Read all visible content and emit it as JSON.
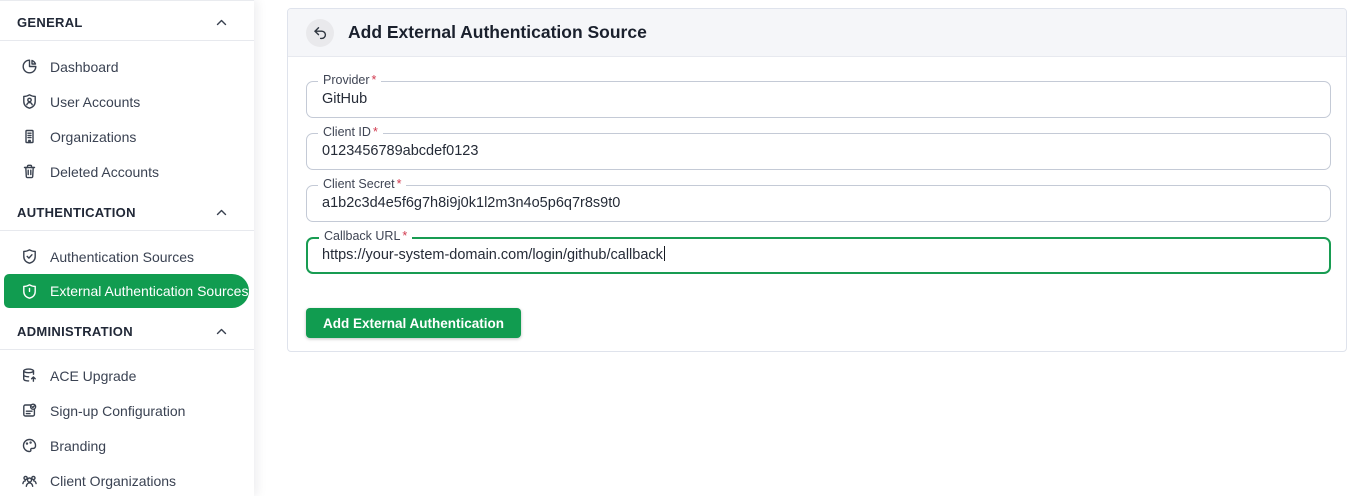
{
  "colors": {
    "accent_green": "#119c50",
    "focus_border_green": "#189c52",
    "required_red": "#d13a4f",
    "card_header_bg": "#f5f6f9"
  },
  "sidebar": {
    "sections": [
      {
        "label": "GENERAL",
        "collapse_icon": "chevron-up-icon",
        "items": [
          {
            "icon": "pie-chart-icon",
            "label": "Dashboard"
          },
          {
            "icon": "user-badge-icon",
            "label": "User Accounts"
          },
          {
            "icon": "building-icon",
            "label": "Organizations"
          },
          {
            "icon": "trash-icon",
            "label": "Deleted Accounts"
          }
        ]
      },
      {
        "label": "AUTHENTICATION",
        "collapse_icon": "chevron-up-icon",
        "items": [
          {
            "icon": "shield-check-icon",
            "label": "Authentication Sources"
          },
          {
            "icon": "shield-alert-icon",
            "label": "External Authentication Sources",
            "active": true
          }
        ]
      },
      {
        "label": "ADMINISTRATION",
        "collapse_icon": "chevron-up-icon",
        "items": [
          {
            "icon": "database-upgrade-icon",
            "label": "ACE Upgrade"
          },
          {
            "icon": "document-check-icon",
            "label": "Sign-up Configuration"
          },
          {
            "icon": "palette-icon",
            "label": "Branding"
          },
          {
            "icon": "people-icon",
            "label": "Client Organizations"
          }
        ]
      }
    ]
  },
  "main": {
    "back_icon": "back-arrow-icon",
    "title": "Add External Authentication Source",
    "required_marker": "*",
    "fields": [
      {
        "label": "Provider",
        "required": true,
        "focused": false,
        "value": "GitHub"
      },
      {
        "label": "Client ID",
        "required": true,
        "focused": false,
        "value": "0123456789abcdef0123"
      },
      {
        "label": "Client Secret",
        "required": true,
        "focused": false,
        "value": "a1b2c3d4e5f6g7h8i9j0k1l2m3n4o5p6q7r8s9t0"
      },
      {
        "label": "Callback URL",
        "required": true,
        "focused": true,
        "value": "https://your-system-domain.com/login/github/callback"
      }
    ],
    "submit_button": "Add External Authentication"
  }
}
